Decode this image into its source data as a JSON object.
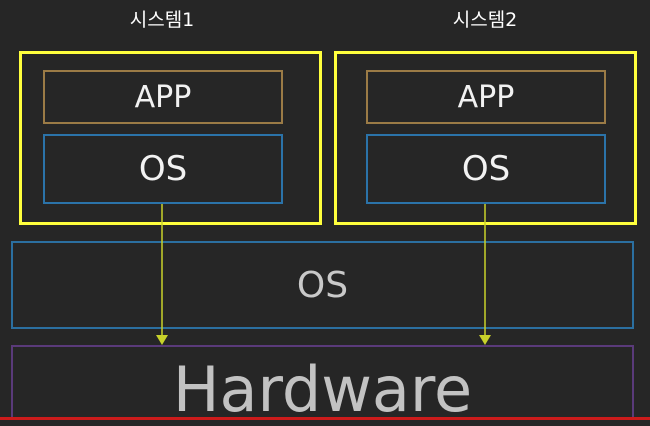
{
  "system1": {
    "title": "시스템1",
    "app_label": "APP",
    "os_label": "OS"
  },
  "system2": {
    "title": "시스템2",
    "app_label": "APP",
    "os_label": "OS"
  },
  "host_os": {
    "label": "OS"
  },
  "hardware": {
    "label": "Hardware"
  },
  "colors": {
    "background": "#262626",
    "system_border": "#ffff3d",
    "app_border": "#9b7b46",
    "os_border": "#2b73a9",
    "hardware_border": "#5a3a7a",
    "arrow": "#c8d22a"
  }
}
